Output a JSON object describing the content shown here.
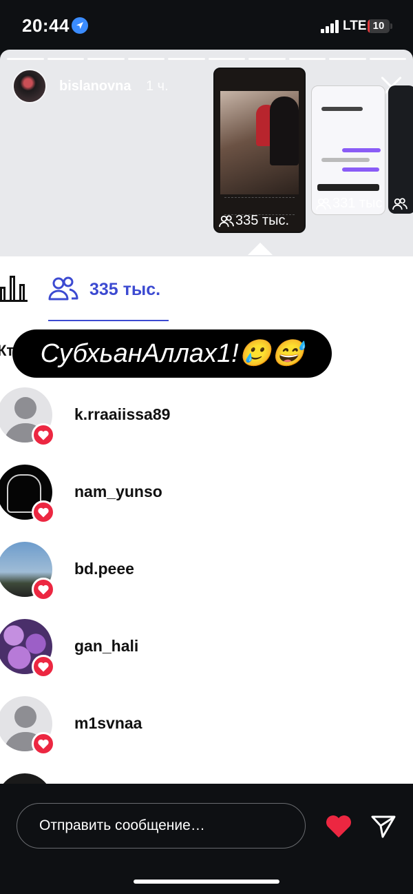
{
  "status_bar": {
    "time": "20:44",
    "network": "LTE",
    "battery": "10",
    "battery_level": 0.1
  },
  "story": {
    "username": "bislanovna",
    "age": "1 ч.",
    "thumbnails": [
      {
        "views": "335 тыс."
      },
      {
        "views": "331 тыс"
      },
      {
        "views": ""
      }
    ]
  },
  "viewers_sheet": {
    "tab_count": "335 тыс.",
    "cut_label": "Кт",
    "overlay_text": "СубхьанАллах1!🥲😅",
    "viewers": [
      {
        "name": "k.rraaiissa89",
        "avatar": "default-avatar"
      },
      {
        "name": "nam_yunso",
        "avatar": "dark-drawing-avatar"
      },
      {
        "name": "bd.peee",
        "avatar": "sky-avatar"
      },
      {
        "name": "gan_hali",
        "avatar": "flowers-avatar"
      },
      {
        "name": "m1svnaa",
        "avatar": "default-avatar"
      }
    ]
  },
  "composer": {
    "placeholder": "Отправить сообщение…"
  },
  "colors": {
    "accent": "#3c4ad1",
    "like": "#ec2741",
    "background": "#0e1013"
  }
}
